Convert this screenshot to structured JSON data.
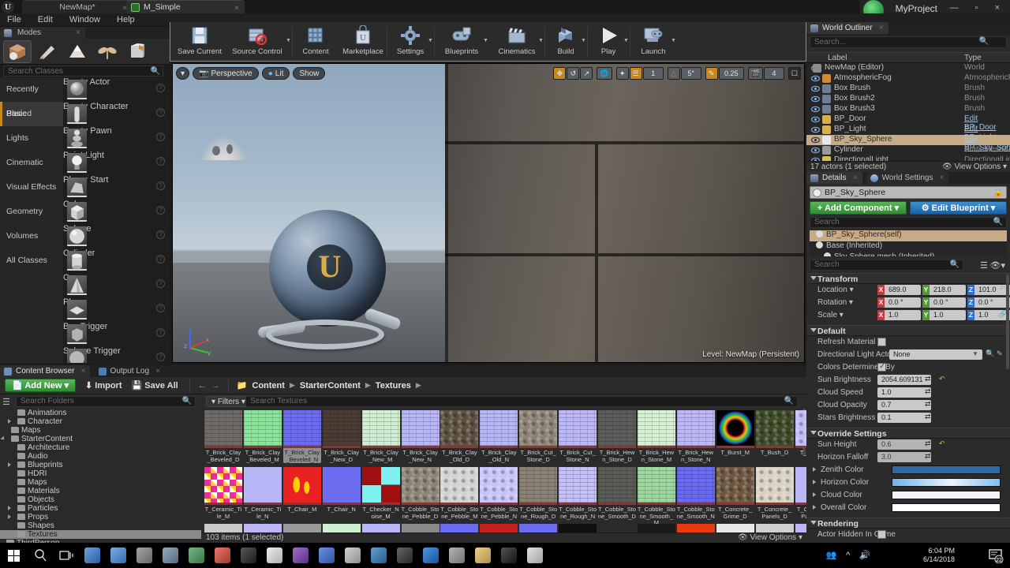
{
  "titlebar": {
    "tab_map": "NewMap*",
    "tab_material": "M_Simple",
    "project_name": "MyProject",
    "close_x": "×",
    "window_buttons": "—  ▫  ×"
  },
  "menubar": {
    "items": [
      "File",
      "Edit",
      "Window",
      "Help"
    ]
  },
  "modes": {
    "tab_label": "Modes",
    "close_x": "×",
    "buttons": [
      "place-mode-icon",
      "paint-mode-icon",
      "landscape-mode-icon",
      "foliage-mode-icon",
      "geometry-edit-mode-icon"
    ],
    "search_placeholder": "Search Classes",
    "categories": [
      {
        "label": "Recently Placed",
        "selected": false
      },
      {
        "label": "Basic",
        "selected": true
      },
      {
        "label": "Lights",
        "selected": false
      },
      {
        "label": "Cinematic",
        "selected": false
      },
      {
        "label": "Visual Effects",
        "selected": false
      },
      {
        "label": "Geometry",
        "selected": false
      },
      {
        "label": "Volumes",
        "selected": false
      },
      {
        "label": "All Classes",
        "selected": false
      }
    ],
    "place_items": [
      {
        "label": "Empty Actor"
      },
      {
        "label": "Empty Character"
      },
      {
        "label": "Empty Pawn"
      },
      {
        "label": "Point Light"
      },
      {
        "label": "Player Start"
      },
      {
        "label": "Cube"
      },
      {
        "label": "Sphere"
      },
      {
        "label": "Cylinder"
      },
      {
        "label": "Cone"
      },
      {
        "label": "Plane"
      },
      {
        "label": "Box Trigger"
      },
      {
        "label": "Sphere Trigger"
      }
    ]
  },
  "toolbar": {
    "items": [
      {
        "label": "Save Current",
        "icon": "floppy-disk-icon",
        "dropdown": false
      },
      {
        "label": "Source Control",
        "icon": "source-control-icon",
        "dropdown": true
      },
      {
        "label": "Content",
        "icon": "content-grid-icon",
        "dropdown": false
      },
      {
        "label": "Marketplace",
        "icon": "marketplace-bag-icon",
        "dropdown": false
      },
      {
        "label": "Settings",
        "icon": "settings-gear-icon",
        "dropdown": true
      },
      {
        "label": "Blueprints",
        "icon": "blueprint-icon",
        "dropdown": true
      },
      {
        "label": "Cinematics",
        "icon": "clapperboard-icon",
        "dropdown": true
      },
      {
        "label": "Build",
        "icon": "build-cube-icon",
        "dropdown": true
      },
      {
        "label": "Play",
        "icon": "play-triangle-icon",
        "dropdown": true
      },
      {
        "label": "Launch",
        "icon": "launch-device-icon",
        "dropdown": true
      }
    ]
  },
  "viewport": {
    "left_buttons": [
      {
        "label": "",
        "icon": "viewport-options-caret-icon"
      },
      {
        "label": "Perspective",
        "icon": "camera-icon"
      },
      {
        "label": "Lit",
        "icon": "lit-sphere-icon"
      },
      {
        "label": "Show",
        "icon": ""
      }
    ],
    "right_buttons": [
      {
        "label": "",
        "icon": "translate-gizmo-icon",
        "active": true
      },
      {
        "label": "",
        "icon": "rotate-gizmo-icon",
        "active": false
      },
      {
        "label": "",
        "icon": "scale-gizmo-icon",
        "active": false
      },
      {
        "label": "",
        "icon": "world-space-icon",
        "active": false
      },
      {
        "label": "",
        "icon": "surface-snap-icon",
        "active": false
      },
      {
        "label": "",
        "icon": "grid-snap-icon",
        "active": true
      },
      {
        "label": "1",
        "icon": "grid-size-value",
        "active": false
      },
      {
        "label": "",
        "icon": "angle-snap-icon",
        "active": false
      },
      {
        "label": "5°",
        "icon": "angle-size-value",
        "active": false
      },
      {
        "label": "",
        "icon": "scale-snap-icon",
        "active": true
      },
      {
        "label": "0.25",
        "icon": "scale-size-value",
        "active": false
      },
      {
        "label": "",
        "icon": "camera-speed-icon",
        "active": false
      },
      {
        "label": "4",
        "icon": "camera-speed-value",
        "active": false
      },
      {
        "label": "",
        "icon": "maximize-viewport-icon",
        "active": false
      }
    ],
    "level_label": "Level: NewMap (Persistent)",
    "gizmo_axes": [
      "z",
      "y",
      "x"
    ]
  },
  "world_outliner": {
    "tab_label": "World Outliner",
    "close_x": "×",
    "search_placeholder": "Search...",
    "columns": {
      "label": "Label",
      "type": "Type"
    },
    "rows": [
      {
        "label": "NewMap (Editor)",
        "type": "World",
        "indent": 10,
        "selected": false,
        "link": false,
        "icon": "#8d8d8d"
      },
      {
        "label": "AtmosphericFog",
        "type": "AtmosphericFog",
        "indent": 22,
        "selected": false,
        "link": false,
        "icon": "#d08a3a"
      },
      {
        "label": "Box Brush",
        "type": "Brush",
        "indent": 22,
        "selected": false,
        "link": false,
        "icon": "#6f7d94"
      },
      {
        "label": "Box Brush2",
        "type": "Brush",
        "indent": 22,
        "selected": false,
        "link": false,
        "icon": "#6f7d94"
      },
      {
        "label": "Box Brush3",
        "type": "Brush",
        "indent": 22,
        "selected": false,
        "link": false,
        "icon": "#6f7d94"
      },
      {
        "label": "BP_Door",
        "type": "Edit BP_Door",
        "indent": 22,
        "selected": false,
        "link": true,
        "icon": "#d6b050"
      },
      {
        "label": "BP_Light",
        "type": "Edit BP_Light",
        "indent": 22,
        "selected": false,
        "link": true,
        "icon": "#d6b050"
      },
      {
        "label": "BP_Sky_Sphere",
        "type": "Edit BP_Sky_Sph",
        "indent": 22,
        "selected": true,
        "link": true,
        "icon": "#e8e8e8"
      },
      {
        "label": "Cylinder",
        "type": "StaticMeshActor",
        "indent": 22,
        "selected": false,
        "link": false,
        "icon": "#9a9a9a"
      },
      {
        "label": "DirectionalLight",
        "type": "DirectionalLight",
        "indent": 22,
        "selected": false,
        "link": false,
        "icon": "#d6c050"
      }
    ],
    "footer": "17 actors (1 selected)",
    "view_options": "View Options"
  },
  "details": {
    "tabs": [
      {
        "label": "Details",
        "selected": true,
        "close_x": "×"
      },
      {
        "label": "World Settings",
        "selected": false,
        "close_x": "×"
      }
    ],
    "actor_name": "BP_Sky_Sphere",
    "add_component": "+ Add Component",
    "edit_blueprint": "Edit Blueprint",
    "component_search_placeholder": "Search",
    "components": [
      {
        "label": "BP_Sky_Sphere(self)",
        "selected": true,
        "indent": 8
      },
      {
        "label": "Base (Inherited)",
        "selected": false,
        "indent": 8
      },
      {
        "label": "Sky Sphere mesh (Inherited)",
        "selected": false,
        "indent": 18
      }
    ],
    "property_search_placeholder": "Search",
    "sections": [
      {
        "title": "Transform",
        "rows": [
          {
            "kind": "vector",
            "label": "Location",
            "dropdown": true,
            "x": "689.0",
            "y": "218.0",
            "z": "101.0",
            "reset": true
          },
          {
            "kind": "vector",
            "label": "Rotation",
            "dropdown": true,
            "x": "0.0 °",
            "y": "0.0 °",
            "z": "0.0 °",
            "reset": false
          },
          {
            "kind": "vector",
            "label": "Scale",
            "dropdown": true,
            "x": "1.0",
            "y": "1.0",
            "z": "1.0",
            "lock": true
          }
        ]
      },
      {
        "title": "Default",
        "rows": [
          {
            "kind": "checkbox",
            "label": "Refresh Material",
            "checked": false
          },
          {
            "kind": "combo",
            "label": "Directional Light Actor",
            "value": "None"
          },
          {
            "kind": "checkbox",
            "label": "Colors Determined By",
            "checked": true
          },
          {
            "kind": "text",
            "label": "Sun Brightness",
            "value": "2054.609131",
            "reset": true
          },
          {
            "kind": "text",
            "label": "Cloud Speed",
            "value": "1.0",
            "reset": false
          },
          {
            "kind": "text",
            "label": "Cloud Opacity",
            "value": "0.7",
            "reset": false
          },
          {
            "kind": "text",
            "label": "Stars Brightness",
            "value": "0.1",
            "reset": false
          }
        ]
      },
      {
        "title": "Override Settings",
        "rows": [
          {
            "kind": "text",
            "label": "Sun Height",
            "value": "0.6",
            "reset": true,
            "disabled": true
          },
          {
            "kind": "text",
            "label": "Horizon Falloff",
            "value": "3.0",
            "reset": false,
            "disabled": true
          },
          {
            "kind": "color",
            "label": "Zenith Color",
            "color": "#2f6aa8"
          },
          {
            "kind": "color",
            "label": "Horizon Color",
            "color": "#9fd0f5"
          },
          {
            "kind": "color",
            "label": "Cloud Color",
            "color": "#f2f4fa"
          },
          {
            "kind": "color",
            "label": "Overall Color",
            "color": "#ffffff"
          }
        ]
      },
      {
        "title": "Rendering",
        "rows": [
          {
            "kind": "checkbox",
            "label": "Actor Hidden In Game",
            "checked": false
          }
        ]
      }
    ]
  },
  "content_browser": {
    "tabs": [
      {
        "label": "Content Browser",
        "selected": true,
        "close_x": "×",
        "icon_color": "#6f8fc0"
      },
      {
        "label": "Output Log",
        "selected": false,
        "close_x": "×",
        "icon_color": "#4a7fb5"
      }
    ],
    "add_new": "Add New",
    "import": "Import",
    "save_all": "Save All",
    "nav_back": "←",
    "nav_forward": "→",
    "breadcrumbs": [
      "Content",
      "StarterContent",
      "Textures"
    ],
    "folder_search_placeholder": "Search Folders",
    "filters_label": "Filters",
    "asset_search_placeholder": "Search Textures",
    "folders": [
      {
        "label": "Animations",
        "indent": 22,
        "expandable": false,
        "selected": false
      },
      {
        "label": "Character",
        "indent": 22,
        "expandable": true,
        "selected": false
      },
      {
        "label": "Maps",
        "indent": 14,
        "expandable": false,
        "selected": false
      },
      {
        "label": "StarterContent",
        "indent": 14,
        "expandable": true,
        "expanded": true,
        "selected": false
      },
      {
        "label": "Architecture",
        "indent": 22,
        "expandable": false,
        "selected": false
      },
      {
        "label": "Audio",
        "indent": 22,
        "expandable": false,
        "selected": false
      },
      {
        "label": "Blueprints",
        "indent": 22,
        "expandable": true,
        "selected": false
      },
      {
        "label": "HDRI",
        "indent": 22,
        "expandable": false,
        "selected": false
      },
      {
        "label": "Maps",
        "indent": 22,
        "expandable": false,
        "selected": false
      },
      {
        "label": "Materials",
        "indent": 22,
        "expandable": false,
        "selected": false
      },
      {
        "label": "Objects",
        "indent": 22,
        "expandable": false,
        "selected": false
      },
      {
        "label": "Particles",
        "indent": 22,
        "expandable": true,
        "selected": false
      },
      {
        "label": "Props",
        "indent": 22,
        "expandable": true,
        "selected": false
      },
      {
        "label": "Shapes",
        "indent": 22,
        "expandable": false,
        "selected": false
      },
      {
        "label": "Textures",
        "indent": 22,
        "expandable": false,
        "selected": true
      },
      {
        "label": "ThirdPerson",
        "indent": 8,
        "expandable": true,
        "selected": false
      }
    ],
    "assets": [
      {
        "name": "T_Brick_Clay_Beveled_D",
        "color": "#6e6a66",
        "pattern": "brick",
        "selected": false
      },
      {
        "name": "T_Brick_Clay_Beveled_M",
        "color": "#8ae49a",
        "pattern": "brick",
        "selected": false
      },
      {
        "name": "T_Brick_Clay_Beveled_N",
        "color": "#6c6cf0",
        "pattern": "brick",
        "selected": true
      },
      {
        "name": "T_Brick_Clay_New_D",
        "color": "#4b3c34",
        "pattern": "brick",
        "selected": false
      },
      {
        "name": "T_Brick_Clay_New_M",
        "color": "#cfeed2",
        "pattern": "brick",
        "selected": false
      },
      {
        "name": "T_Brick_Clay_New_N",
        "color": "#b9b6f7",
        "pattern": "brick",
        "selected": false
      },
      {
        "name": "T_Brick_Clay_Old_D",
        "color": "#5b4f3f",
        "pattern": "noise",
        "selected": false
      },
      {
        "name": "T_Brick_Clay_Old_N",
        "color": "#b9b6f7",
        "pattern": "brick",
        "selected": false
      },
      {
        "name": "T_Brick_Cut_Stone_D",
        "color": "#8c8274",
        "pattern": "noise",
        "selected": false
      },
      {
        "name": "T_Brick_Cut_Stone_N",
        "color": "#bcb8f5",
        "pattern": "brick",
        "selected": false
      },
      {
        "name": "T_Brick_Hewn_Stone_D",
        "color": "#5c5c5c",
        "pattern": "brick",
        "selected": false
      },
      {
        "name": "T_Brick_Hewn_Stone_M",
        "color": "#d5efd3",
        "pattern": "brick",
        "selected": false
      },
      {
        "name": "T_Brick_Hewn_Stone_N",
        "color": "#bcb8f5",
        "pattern": "brick",
        "selected": false
      },
      {
        "name": "T_Burst_M",
        "color": "#0a0a0a",
        "pattern": "burst",
        "selected": false
      },
      {
        "name": "T_Bush_D",
        "color": "#3d4a28",
        "pattern": "noise",
        "selected": false
      },
      {
        "name": "T_Bush_N",
        "color": "#c0bcf7",
        "pattern": "noise",
        "selected": false
      },
      {
        "name": "T_Ceramic_Tile_M",
        "color": "#ef2a9a",
        "pattern": "checker-pink",
        "selected": false
      },
      {
        "name": "T_Ceramic_Tile_N",
        "color": "#b9b6f7",
        "pattern": "flat",
        "selected": false
      },
      {
        "name": "T_Chair_M",
        "color": "#e82222",
        "pattern": "chair",
        "selected": false
      },
      {
        "name": "T_Chair_N",
        "color": "#6c6cf0",
        "pattern": "flat",
        "selected": false
      },
      {
        "name": "T_Checker_Noise_M",
        "color": "#a01010",
        "pattern": "checker-red",
        "selected": false
      },
      {
        "name": "T_Cobble_Stone_Pebble_D",
        "color": "#8b8373",
        "pattern": "noise",
        "selected": false
      },
      {
        "name": "T_Cobble_Stone_Pebble_M",
        "color": "#d2d2d2",
        "pattern": "noise",
        "selected": false
      },
      {
        "name": "T_Cobble_Stone_Pebble_N",
        "color": "#c7c3f8",
        "pattern": "noise",
        "selected": false
      },
      {
        "name": "T_Cobble_Stone_Rough_D",
        "color": "#8a8375",
        "pattern": "brick",
        "selected": false
      },
      {
        "name": "T_Cobble_Stone_Rough_N",
        "color": "#c4c0f8",
        "pattern": "brick",
        "selected": false
      },
      {
        "name": "T_Cobble_Stone_Smooth_D",
        "color": "#585b56",
        "pattern": "brick",
        "selected": false
      },
      {
        "name": "T_Cobble_Stone_Smooth_M",
        "color": "#9dd79f",
        "pattern": "brick",
        "selected": false
      },
      {
        "name": "T_Cobble_Stone_Smooth_N",
        "color": "#6a6af2",
        "pattern": "brick",
        "selected": false
      },
      {
        "name": "T_Concrete_Grime_D",
        "color": "#6d5740",
        "pattern": "noise",
        "selected": false
      },
      {
        "name": "T_Concrete_Panels_D",
        "color": "#d8d2c2",
        "pattern": "noise",
        "selected": false
      },
      {
        "name": "T_Concrete_Panels_N",
        "color": "#bcb8f7",
        "pattern": "flat",
        "selected": false
      }
    ],
    "footer": "103 items (1 selected)",
    "view_options": "View Options"
  },
  "taskbar": {
    "time": "6:04 PM",
    "date": "6/14/2018",
    "notification_count": "22",
    "icons": [
      {
        "name": "start-icon",
        "color": "#ffffff"
      },
      {
        "name": "search-icon",
        "color": "#dddddd"
      },
      {
        "name": "task-view-icon",
        "color": "#dddddd"
      },
      {
        "name": "cortana-icon",
        "color": "#3a7fd5"
      },
      {
        "name": "shield-icon",
        "color": "#4a90e2"
      },
      {
        "name": "media-icon",
        "color": "#888888"
      },
      {
        "name": "monitor-icon",
        "color": "#6f8fa8"
      },
      {
        "name": "file-explorer-icon",
        "color": "#4a9f5a"
      },
      {
        "name": "chrome-icon",
        "color": "#e04a3a"
      },
      {
        "name": "epic-games-icon",
        "color": "#222222"
      },
      {
        "name": "mail-icon",
        "color": "#e8e8e8"
      },
      {
        "name": "purple-app-icon",
        "color": "#7b3fb5"
      },
      {
        "name": "download-icon",
        "color": "#3a6fd5"
      },
      {
        "name": "steam-icon",
        "color": "#c0c0c0"
      },
      {
        "name": "vscode-icon",
        "color": "#2b7fc0"
      },
      {
        "name": "dark-app-icon",
        "color": "#333333"
      },
      {
        "name": "location-icon",
        "color": "#1a6fd5"
      },
      {
        "name": "browser-icon",
        "color": "#9a9a9a"
      },
      {
        "name": "folder-icon",
        "color": "#e8c060"
      },
      {
        "name": "epic-launcher-icon",
        "color": "#1a1a1a"
      },
      {
        "name": "unreal-editor-icon",
        "color": "#d8d8d8"
      }
    ]
  }
}
